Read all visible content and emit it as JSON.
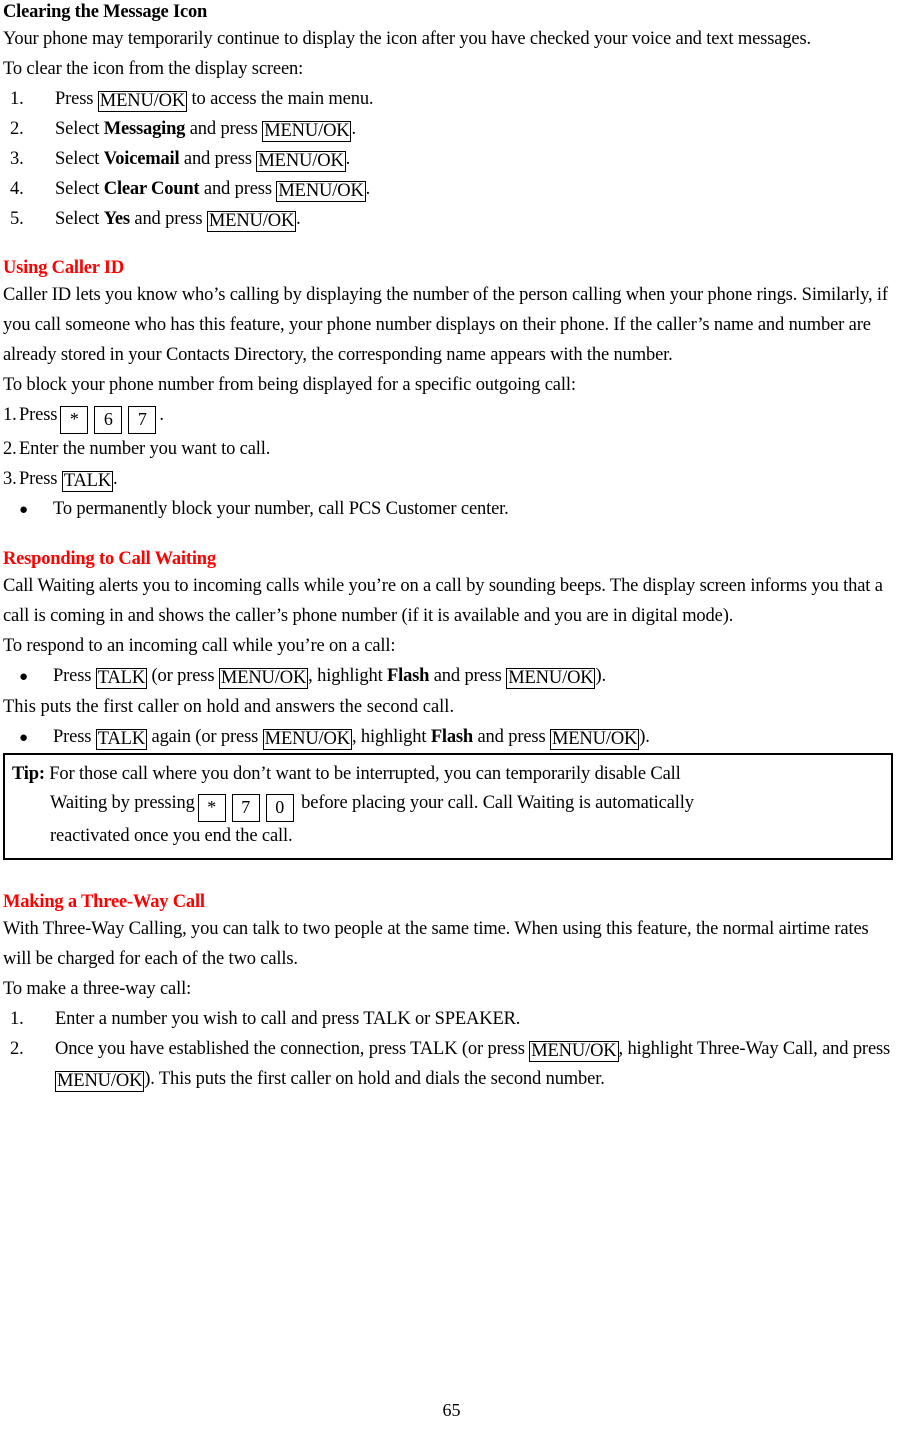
{
  "document": {
    "page_number": "65"
  },
  "colors": {
    "heading_red": "#ff0000",
    "heading_black": "#000000",
    "text": "#000000",
    "page_background": "#ffffff"
  },
  "sections": [
    {
      "id": "clearing-message-icon",
      "heading": "Clearing the Message Icon",
      "heading_color": "#000000",
      "paragraphs": [
        "Your phone may temporarily continue to display the icon after you have checked your voice and text messages.",
        "To clear the icon from the display screen:"
      ],
      "steps": [
        {
          "number": "1.",
          "pre": "Press ",
          "key": "MENU/OK",
          "post": " to access the main menu."
        },
        {
          "number": "2.",
          "pre": "Select ",
          "bold": "Messaging",
          "mid": " and press ",
          "key": "MENU/OK",
          "post": "."
        },
        {
          "number": "3.",
          "pre": "Select ",
          "bold": "Voicemail",
          "mid": " and press ",
          "key": "MENU/OK",
          "post": "."
        },
        {
          "number": "4.",
          "pre": "Select ",
          "bold": "Clear Count",
          "mid": " and press ",
          "key": "MENU/OK",
          "post": "."
        },
        {
          "number": "5.",
          "pre": "Select ",
          "bold": "Yes",
          "mid": " and press ",
          "key": "MENU/OK",
          "post": "."
        }
      ]
    },
    {
      "id": "using-caller-id",
      "heading": "Using Caller ID",
      "heading_color": "#ff0000",
      "paragraphs": [
        "Caller ID lets you know who’s calling by displaying the number of the person calling when your phone rings. Similarly, if you call someone who has this feature, your phone number displays on their phone. If the caller’s name and number are already stored in your Contacts Directory, the corresponding name appears with the number.",
        "To block your phone number from being displayed for a specific outgoing call:"
      ],
      "steps": [
        {
          "number": "1.",
          "pre": "Press",
          "keypad": [
            "*",
            "6",
            "7"
          ],
          "post": "."
        },
        {
          "number": "2.",
          "pre": "Enter the number you want to call."
        },
        {
          "number": "3.",
          "pre": "Press ",
          "key": "TALK",
          "post": "."
        }
      ],
      "bullets": [
        {
          "marker": "●",
          "text": "To permanently block your number, call PCS Customer center."
        }
      ]
    },
    {
      "id": "responding-to-call-waiting",
      "heading": "Responding to Call Waiting",
      "heading_color": "#ff0000",
      "paragraphs": [
        "Call Waiting alerts you to incoming calls while you’re on a call by sounding beeps. The display screen informs you that a call is coming in and shows the caller’s phone number (if it is available and you are in digital mode).",
        "To respond to an incoming call while you’re on a call:"
      ],
      "bullet_one": {
        "marker": "●",
        "p1": "Press ",
        "k1": "TALK",
        "p2": " (or press ",
        "k2": "MENU/OK",
        "p3": ", highlight ",
        "bold": "Flash",
        "p4": " and press ",
        "k3": "MENU/OK",
        "p5": ")."
      },
      "middle_line": "This puts the first caller on hold and answers the second call.",
      "bullet_two": {
        "marker": "●",
        "p1": "Press ",
        "k1": "TALK",
        "p2": " again (or press ",
        "k2": "MENU/OK",
        "p3": ", highlight ",
        "bold": "Flash",
        "p4": " and press ",
        "k3": "MENU/OK",
        "p5": ")."
      },
      "tip": {
        "label": "Tip:",
        "line1": " For those call where you don’t want to be interrupted, you can temporarily disable Call",
        "line2_pre": "Waiting by pressing",
        "keypad": [
          "*",
          "7",
          "0"
        ],
        "line2_post": "before placing your call. Call Waiting is automatically",
        "line3": "reactivated once you end the call."
      }
    },
    {
      "id": "making-three-way-call",
      "heading": "Making a Three-Way Call",
      "heading_color": "#ff0000",
      "paragraphs": [
        "With Three-Way Calling, you can talk to two people at the same time. When using this feature, the normal airtime rates will be charged for each of the two calls.",
        "To make a three-way call:"
      ],
      "steps": [
        {
          "number": "1.",
          "text": "Enter a number you wish to call and press TALK or SPEAKER."
        },
        {
          "number": "2.",
          "p1": "Once you have established the connection, press TALK (or press ",
          "k1": "MENU/OK",
          "p2": ", highlight Three-Way Call, and press ",
          "k2": "MENU/OK",
          "p3": "). This puts the first caller on hold and dials the second number."
        }
      ]
    }
  ]
}
